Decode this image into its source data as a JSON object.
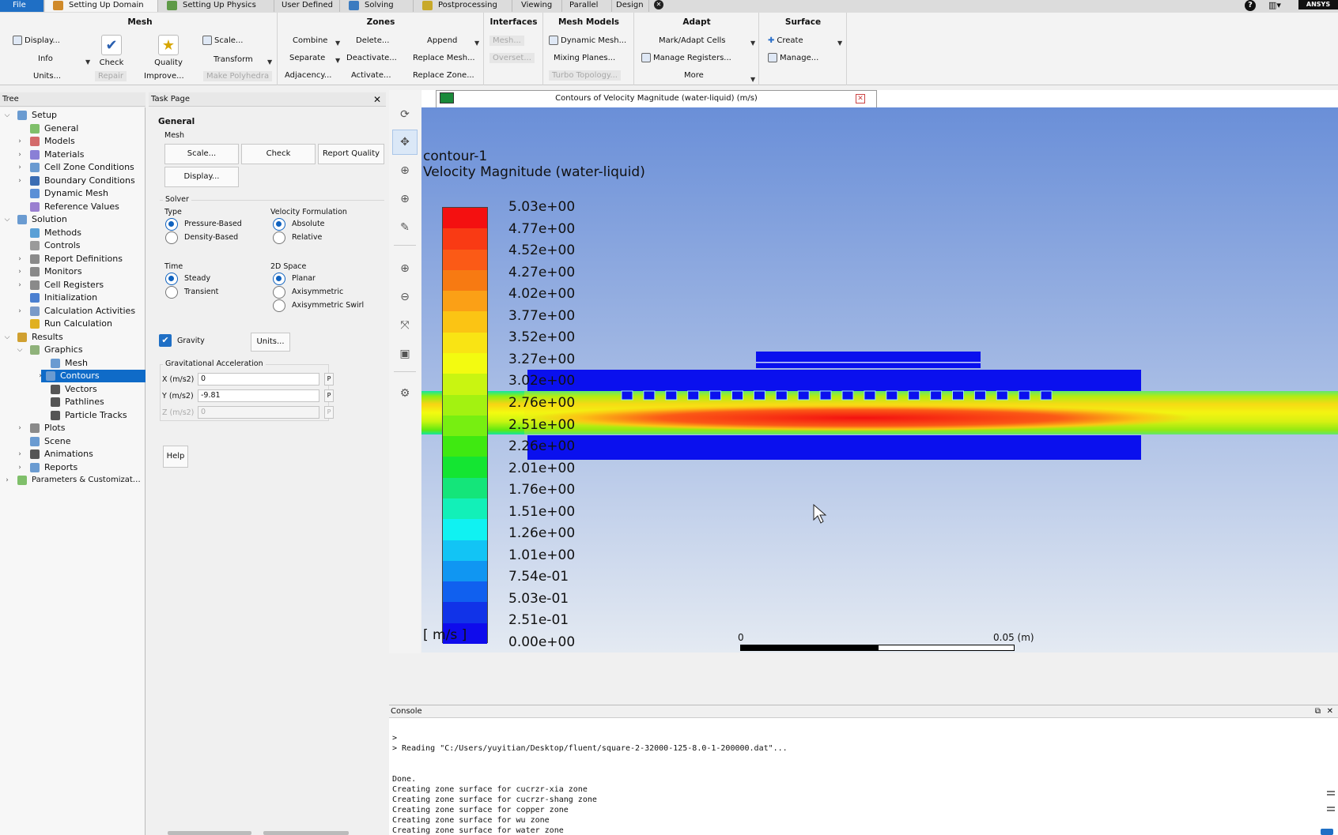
{
  "tabs": [
    {
      "label": "File",
      "color": "#1f6fc5"
    },
    {
      "label": "Setting Up Domain",
      "color": "#d08a2a"
    },
    {
      "label": "Setting Up Physics",
      "color": "#5e9a47"
    },
    {
      "label": "User Defined",
      "color": ""
    },
    {
      "label": "Solving",
      "color": "#3b7bc0"
    },
    {
      "label": "Postprocessing",
      "color": "#c8a92a"
    },
    {
      "label": "Viewing",
      "color": ""
    },
    {
      "label": "Parallel",
      "color": ""
    },
    {
      "label": "Design",
      "color": ""
    }
  ],
  "brand": "ANSYS",
  "ribbon": {
    "mesh": {
      "title": "Mesh",
      "display": "Display...",
      "info": "Info",
      "units": "Units...",
      "check": "Check",
      "repair": "Repair",
      "quality": "Quality",
      "improve": "Improve...",
      "scale": "Scale...",
      "transform": "Transform",
      "make_polyhedra": "Make Polyhedra"
    },
    "zones": {
      "title": "Zones",
      "combine": "Combine",
      "separate": "Separate",
      "adjacency": "Adjacency...",
      "delete": "Delete...",
      "deactivate": "Deactivate...",
      "activate": "Activate...",
      "append": "Append",
      "replace_mesh": "Replace Mesh...",
      "replace_zone": "Replace Zone..."
    },
    "interfaces": {
      "title": "Interfaces",
      "mesh": "Mesh...",
      "overset": "Overset..."
    },
    "mesh_models": {
      "title": "Mesh Models",
      "dynamic_mesh": "Dynamic Mesh...",
      "mixing_planes": "Mixing Planes...",
      "turbo_topology": "Turbo Topology..."
    },
    "adapt": {
      "title": "Adapt",
      "mark_adapt": "Mark/Adapt Cells",
      "manage_registers": "Manage Registers...",
      "more": "More"
    },
    "surface": {
      "title": "Surface",
      "create": "Create",
      "manage": "Manage..."
    }
  },
  "tree": {
    "title": "Tree",
    "items": [
      {
        "label": "Setup",
        "level": 0,
        "arrow": "open",
        "icon": "#6a9bd1"
      },
      {
        "label": "General",
        "level": 1,
        "arrow": "",
        "icon": "#7fbf6a"
      },
      {
        "label": "Models",
        "level": 1,
        "arrow": "closed",
        "icon": "#d36a6a"
      },
      {
        "label": "Materials",
        "level": 1,
        "arrow": "closed",
        "icon": "#8a7fd6"
      },
      {
        "label": "Cell Zone Conditions",
        "level": 1,
        "arrow": "closed",
        "icon": "#6a9bd1"
      },
      {
        "label": "Boundary Conditions",
        "level": 1,
        "arrow": "closed",
        "icon": "#3b6db3"
      },
      {
        "label": "Dynamic Mesh",
        "level": 1,
        "arrow": "",
        "icon": "#5a8fd6"
      },
      {
        "label": "Reference Values",
        "level": 1,
        "arrow": "",
        "icon": "#9a7fd0"
      },
      {
        "label": "Solution",
        "level": 0,
        "arrow": "open",
        "icon": "#6a9bd1"
      },
      {
        "label": "Methods",
        "level": 1,
        "arrow": "",
        "icon": "#5aa0d6"
      },
      {
        "label": "Controls",
        "level": 1,
        "arrow": "",
        "icon": "#9a9a9a"
      },
      {
        "label": "Report Definitions",
        "level": 1,
        "arrow": "closed",
        "icon": "#8a8a8a"
      },
      {
        "label": "Monitors",
        "level": 1,
        "arrow": "closed",
        "icon": "#8a8a8a"
      },
      {
        "label": "Cell Registers",
        "level": 1,
        "arrow": "closed",
        "icon": "#8a8a8a"
      },
      {
        "label": "Initialization",
        "level": 1,
        "arrow": "",
        "icon": "#4a7fd0"
      },
      {
        "label": "Calculation Activities",
        "level": 1,
        "arrow": "closed",
        "icon": "#7a9ac8"
      },
      {
        "label": "Run Calculation",
        "level": 1,
        "arrow": "",
        "icon": "#e0b020"
      },
      {
        "label": "Results",
        "level": 0,
        "arrow": "open",
        "icon": "#d0a030"
      },
      {
        "label": "Graphics",
        "level": 1,
        "arrow": "open",
        "icon": "#8fb27a"
      },
      {
        "label": "Mesh",
        "level": 2,
        "arrow": "",
        "icon": "#6a9bd1"
      },
      {
        "label": "Contours",
        "level": 2,
        "arrow": "closed",
        "icon": "#6a9bd1",
        "selected": true
      },
      {
        "label": "Vectors",
        "level": 2,
        "arrow": "",
        "icon": "#555555"
      },
      {
        "label": "Pathlines",
        "level": 2,
        "arrow": "",
        "icon": "#555555"
      },
      {
        "label": "Particle Tracks",
        "level": 2,
        "arrow": "",
        "icon": "#555555"
      },
      {
        "label": "Plots",
        "level": 1,
        "arrow": "closed",
        "icon": "#8a8a8a"
      },
      {
        "label": "Scene",
        "level": 1,
        "arrow": "",
        "icon": "#6a9bd1"
      },
      {
        "label": "Animations",
        "level": 1,
        "arrow": "closed",
        "icon": "#555555"
      },
      {
        "label": "Reports",
        "level": 1,
        "arrow": "closed",
        "icon": "#6a9bd1"
      },
      {
        "label": "Parameters & Customizat…",
        "level": 0,
        "arrow": "closed",
        "icon": "#7fbf6a"
      }
    ]
  },
  "task": {
    "title": "Task Page",
    "general": "General",
    "mesh_label": "Mesh",
    "scale": "Scale...",
    "check": "Check",
    "report_quality": "Report Quality",
    "display": "Display...",
    "solver_label": "Solver",
    "type_label": "Type",
    "pressure_based": "Pressure-Based",
    "density_based": "Density-Based",
    "velocity_label": "Velocity Formulation",
    "absolute": "Absolute",
    "relative": "Relative",
    "time_label": "Time",
    "steady": "Steady",
    "transient": "Transient",
    "space_label": "2D Space",
    "planar": "Planar",
    "axisymmetric": "Axisymmetric",
    "axisymmetric_swirl": "Axisymmetric Swirl",
    "gravity": "Gravity",
    "units": "Units...",
    "grav_accel": "Gravitational Acceleration",
    "x_label": "X (m/s2)",
    "x_value": "0",
    "y_label": "Y (m/s2)",
    "y_value": "-9.81",
    "z_label": "Z (m/s2)",
    "z_value": "0",
    "p": "P",
    "help": "Help"
  },
  "graphics": {
    "tab_title": "Contours of Velocity Magnitude (water-liquid)  (m/s)",
    "contour_name": "contour-1",
    "variable": "Velocity Magnitude (water-liquid)",
    "unit": "[ m/s ]",
    "legend_labels": [
      "5.03e+00",
      "4.77e+00",
      "4.52e+00",
      "4.27e+00",
      "4.02e+00",
      "3.77e+00",
      "3.52e+00",
      "3.27e+00",
      "3.02e+00",
      "2.76e+00",
      "2.51e+00",
      "2.26e+00",
      "2.01e+00",
      "1.76e+00",
      "1.51e+00",
      "1.26e+00",
      "1.01e+00",
      "7.54e-01",
      "5.03e-01",
      "2.51e-01",
      "0.00e+00"
    ],
    "legend_colors": [
      "#f41010",
      "#f93a14",
      "#fb5a16",
      "#f77a12",
      "#fba016",
      "#fbc414",
      "#f9e414",
      "#f3fb10",
      "#c9f511",
      "#a3f211",
      "#77ef11",
      "#3fe911",
      "#14e532",
      "#14e57a",
      "#12f0b8",
      "#10f2f2",
      "#12c4f5",
      "#1096f2",
      "#1060ef",
      "#1133e8",
      "#0f0bec"
    ],
    "scale_zero": "0",
    "scale_end": "0.05 (m)"
  },
  "console": {
    "title": "Console",
    "lines": [
      ">",
      "> Reading \"C:/Users/yuyitian/Desktop/fluent/square-2-32000-125-8.0-1-200000.dat\"...",
      "",
      "",
      "Done.",
      "Creating zone surface for cucrzr-xia zone",
      "Creating zone surface for cucrzr-shang zone",
      "Creating zone surface for copper zone",
      "Creating zone surface for wu zone",
      "Creating zone surface for water zone"
    ]
  }
}
